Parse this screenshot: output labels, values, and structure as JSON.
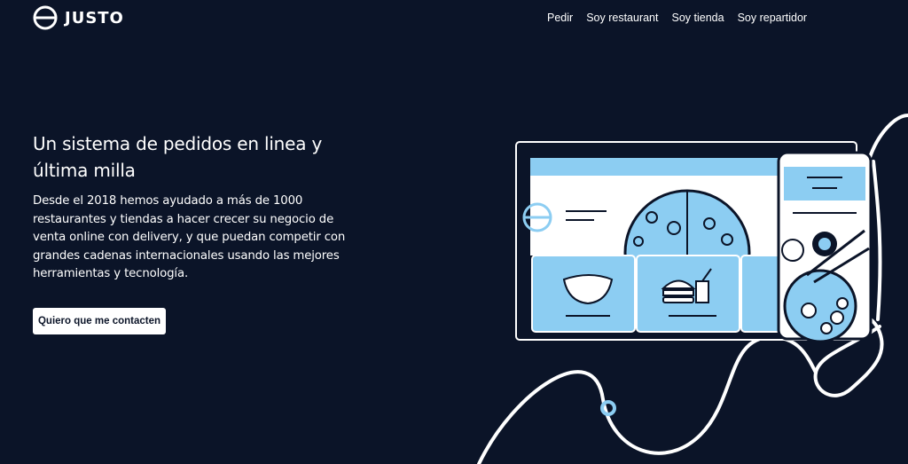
{
  "brand": {
    "name": "JUSTO",
    "logo_icon": "justo-logo-icon"
  },
  "nav": {
    "items": [
      {
        "label": "Pedir"
      },
      {
        "label": "Soy restaurant"
      },
      {
        "label": "Soy tienda"
      },
      {
        "label": "Soy repartidor"
      }
    ]
  },
  "hero": {
    "title": "Un sistema de pedidos en linea y última milla",
    "description": "Desde el 2018 hemos ayudado a más de 1000 restaurantes y tiendas a hacer crecer su negocio de venta online con delivery, y que puedan competir con grandes cadenas internacionales usando las mejores herramientas y tecnología.",
    "cta_label": "Quiero que me contacten"
  },
  "colors": {
    "background": "#0b1428",
    "accent_blue": "#8ccdf2",
    "text": "#ffffff"
  }
}
